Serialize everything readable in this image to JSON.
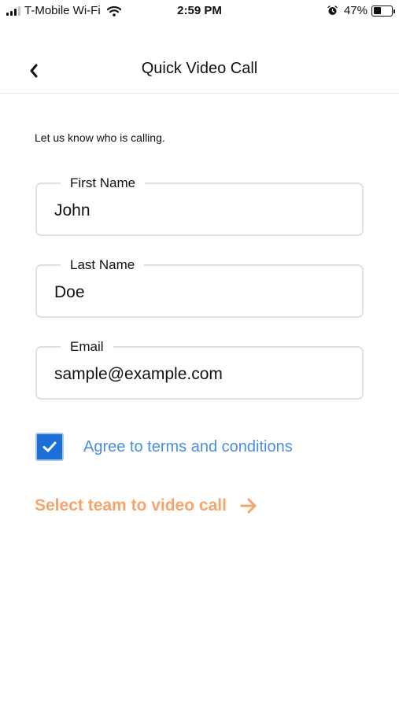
{
  "status_bar": {
    "carrier": "T-Mobile Wi-Fi",
    "time": "2:59 PM",
    "battery_percent": "47%",
    "battery_level": 0.47,
    "signal_bars": 3,
    "signal_bars_total": 4,
    "icons": [
      "signal-icon",
      "wifi-icon",
      "alarm-icon",
      "battery-icon"
    ]
  },
  "nav": {
    "back_icon": "chevron-left-icon",
    "title": "Quick Video Call"
  },
  "form": {
    "intro": "Let us know who is calling.",
    "fields": [
      {
        "label": "First Name",
        "value": "John"
      },
      {
        "label": "Last Name",
        "value": "Doe"
      },
      {
        "label": "Email",
        "value": "sample@example.com"
      }
    ],
    "agree": {
      "label": "Agree to terms and conditions",
      "checked": true
    },
    "cta": {
      "label": "Select team to video call",
      "icon": "arrow-right-icon"
    }
  },
  "colors": {
    "checkbox_blue": "#1b6fd6",
    "link_blue": "#4a8ee3",
    "cta_orange": "#f5a46b",
    "field_border": "#e2e2e2"
  }
}
